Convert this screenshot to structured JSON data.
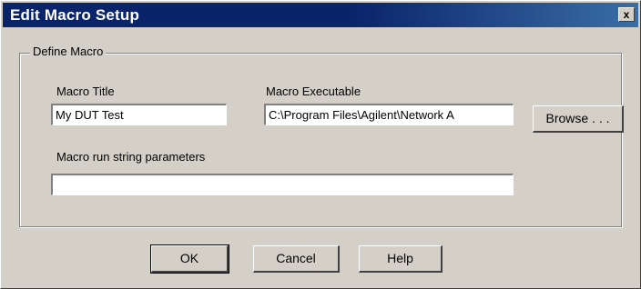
{
  "window": {
    "title": "Edit Macro Setup",
    "close_glyph": "x"
  },
  "group": {
    "label": "Define Macro"
  },
  "fields": {
    "macro_title_label": "Macro Title",
    "macro_title_value": "My DUT Test",
    "macro_executable_label": "Macro Executable",
    "macro_executable_value": "C:\\Program Files\\Agilent\\Network A",
    "run_params_label": "Macro run string parameters",
    "run_params_value": ""
  },
  "buttons": {
    "browse": "Browse . . .",
    "ok": "OK",
    "cancel": "Cancel",
    "help": "Help"
  }
}
